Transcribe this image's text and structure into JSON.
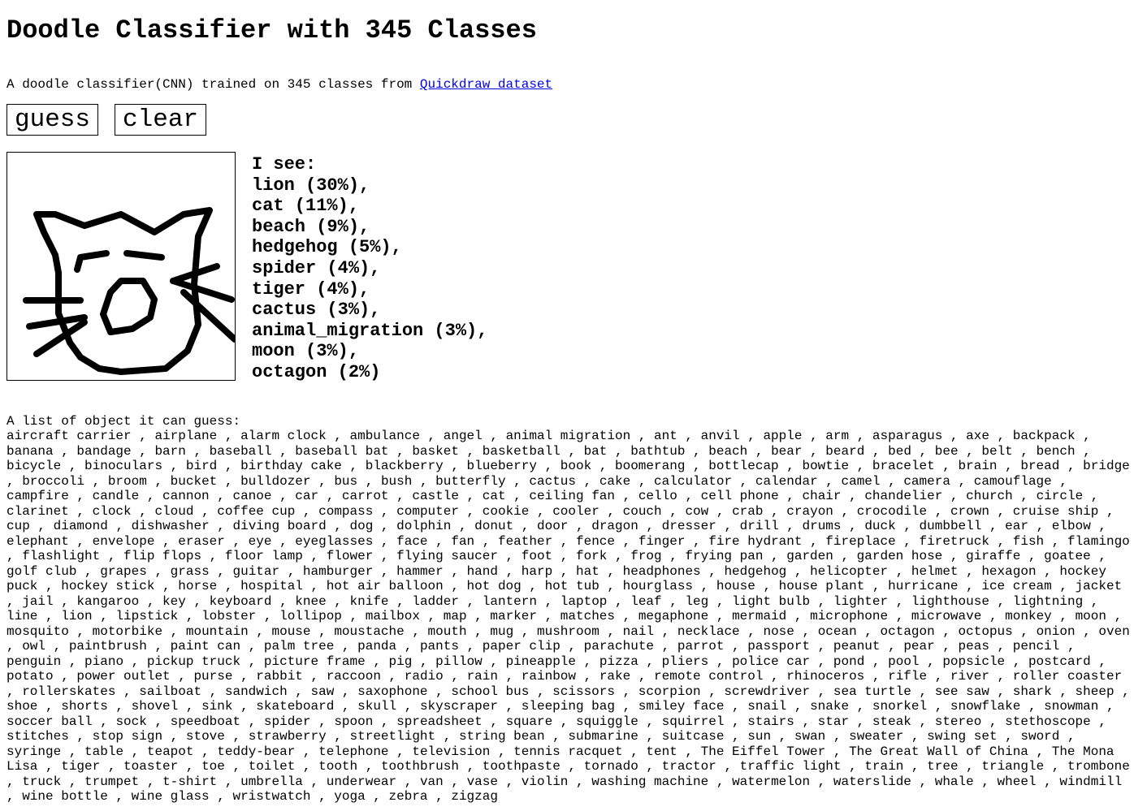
{
  "title": "Doodle Classifier with 345 Classes",
  "subtitle": {
    "text": "A doodle classifier(CNN) trained on 345 classes from ",
    "link_text": "Quickdraw dataset",
    "link_color": "#0000ee"
  },
  "buttons": {
    "guess": "guess",
    "clear": "clear"
  },
  "predictions": {
    "heading": "I see:",
    "items": [
      "lion (30%),",
      "cat (11%),",
      "beach (9%),",
      "hedgehog (5%),",
      "spider (4%),",
      "tiger (4%),",
      "cactus (3%),",
      "animal_migration (3%),",
      "moon (3%),",
      "octagon (2%)"
    ]
  },
  "class_list": {
    "heading": "A list of object it can guess:",
    "items": [
      "aircraft carrier",
      "airplane",
      "alarm clock",
      "ambulance",
      "angel",
      "animal migration",
      "ant",
      "anvil",
      "apple",
      "arm",
      "asparagus",
      "axe",
      "backpack",
      "banana",
      "bandage",
      "barn",
      "baseball",
      "baseball bat",
      "basket",
      "basketball",
      "bat",
      "bathtub",
      "beach",
      "bear",
      "beard",
      "bed",
      "bee",
      "belt",
      "bench",
      "bicycle",
      "binoculars",
      "bird",
      "birthday cake",
      "blackberry",
      "blueberry",
      "book",
      "boomerang",
      "bottlecap",
      "bowtie",
      "bracelet",
      "brain",
      "bread",
      "bridge",
      "broccoli",
      "broom",
      "bucket",
      "bulldozer",
      "bus",
      "bush",
      "butterfly",
      "cactus",
      "cake",
      "calculator",
      "calendar",
      "camel",
      "camera",
      "camouflage",
      "campfire",
      "candle",
      "cannon",
      "canoe",
      "car",
      "carrot",
      "castle",
      "cat",
      "ceiling fan",
      "cello",
      "cell phone",
      "chair",
      "chandelier",
      "church",
      "circle",
      "clarinet",
      "clock",
      "cloud",
      "coffee cup",
      "compass",
      "computer",
      "cookie",
      "cooler",
      "couch",
      "cow",
      "crab",
      "crayon",
      "crocodile",
      "crown",
      "cruise ship",
      "cup",
      "diamond",
      "dishwasher",
      "diving board",
      "dog",
      "dolphin",
      "donut",
      "door",
      "dragon",
      "dresser",
      "drill",
      "drums",
      "duck",
      "dumbbell",
      "ear",
      "elbow",
      "elephant",
      "envelope",
      "eraser",
      "eye",
      "eyeglasses",
      "face",
      "fan",
      "feather",
      "fence",
      "finger",
      "fire hydrant",
      "fireplace",
      "firetruck",
      "fish",
      "flamingo",
      "flashlight",
      "flip flops",
      "floor lamp",
      "flower",
      "flying saucer",
      "foot",
      "fork",
      "frog",
      "frying pan",
      "garden",
      "garden hose",
      "giraffe",
      "goatee",
      "golf club",
      "grapes",
      "grass",
      "guitar",
      "hamburger",
      "hammer",
      "hand",
      "harp",
      "hat",
      "headphones",
      "hedgehog",
      "helicopter",
      "helmet",
      "hexagon",
      "hockey puck",
      "hockey stick",
      "horse",
      "hospital",
      "hot air balloon",
      "hot dog",
      "hot tub",
      "hourglass",
      "house",
      "house plant",
      "hurricane",
      "ice cream",
      "jacket",
      "jail",
      "kangaroo",
      "key",
      "keyboard",
      "knee",
      "knife",
      "ladder",
      "lantern",
      "laptop",
      "leaf",
      "leg",
      "light bulb",
      "lighter",
      "lighthouse",
      "lightning",
      "line",
      "lion",
      "lipstick",
      "lobster",
      "lollipop",
      "mailbox",
      "map",
      "marker",
      "matches",
      "megaphone",
      "mermaid",
      "microphone",
      "microwave",
      "monkey",
      "moon",
      "mosquito",
      "motorbike",
      "mountain",
      "mouse",
      "moustache",
      "mouth",
      "mug",
      "mushroom",
      "nail",
      "necklace",
      "nose",
      "ocean",
      "octagon",
      "octopus",
      "onion",
      "oven",
      "owl",
      "paintbrush",
      "paint can",
      "palm tree",
      "panda",
      "pants",
      "paper clip",
      "parachute",
      "parrot",
      "passport",
      "peanut",
      "pear",
      "peas",
      "pencil",
      "penguin",
      "piano",
      "pickup truck",
      "picture frame",
      "pig",
      "pillow",
      "pineapple",
      "pizza",
      "pliers",
      "police car",
      "pond",
      "pool",
      "popsicle",
      "postcard",
      "potato",
      "power outlet",
      "purse",
      "rabbit",
      "raccoon",
      "radio",
      "rain",
      "rainbow",
      "rake",
      "remote control",
      "rhinoceros",
      "rifle",
      "river",
      "roller coaster",
      "rollerskates",
      "sailboat",
      "sandwich",
      "saw",
      "saxophone",
      "school bus",
      "scissors",
      "scorpion",
      "screwdriver",
      "sea turtle",
      "see saw",
      "shark",
      "sheep",
      "shoe",
      "shorts",
      "shovel",
      "sink",
      "skateboard",
      "skull",
      "skyscraper",
      "sleeping bag",
      "smiley face",
      "snail",
      "snake",
      "snorkel",
      "snowflake",
      "snowman",
      "soccer ball",
      "sock",
      "speedboat",
      "spider",
      "spoon",
      "spreadsheet",
      "square",
      "squiggle",
      "squirrel",
      "stairs",
      "star",
      "steak",
      "stereo",
      "stethoscope",
      "stitches",
      "stop sign",
      "stove",
      "strawberry",
      "streetlight",
      "string bean",
      "submarine",
      "suitcase",
      "sun",
      "swan",
      "sweater",
      "swing set",
      "sword",
      "syringe",
      "table",
      "teapot",
      "teddy-bear",
      "telephone",
      "television",
      "tennis racquet",
      "tent",
      "The Eiffel Tower",
      "The Great Wall of China",
      "The Mona Lisa",
      "tiger",
      "toaster",
      "toe",
      "toilet",
      "tooth",
      "toothbrush",
      "toothpaste",
      "tornado",
      "tractor",
      "traffic light",
      "train",
      "tree",
      "triangle",
      "trombone",
      "truck",
      "trumpet",
      "t-shirt",
      "umbrella",
      "underwear",
      "van",
      "vase",
      "violin",
      "washing machine",
      "watermelon",
      "waterslide",
      "whale",
      "wheel",
      "windmill",
      "wine bottle",
      "wine glass",
      "wristwatch",
      "yoga",
      "zebra",
      "zigzag"
    ]
  }
}
